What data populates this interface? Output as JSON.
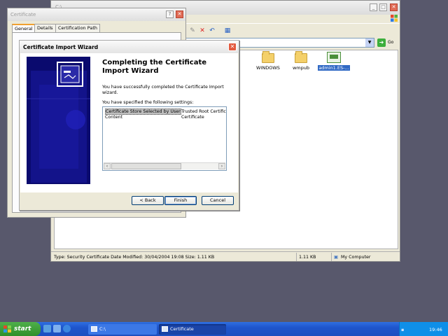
{
  "explorer": {
    "title": "C:\\",
    "address_value": "",
    "go_label": "Go",
    "files": [
      {
        "label": "WINDOWS",
        "kind": "folder",
        "selected": false
      },
      {
        "label": "wmpub",
        "kind": "folder",
        "selected": false
      },
      {
        "label": "admin1.ES-...",
        "kind": "certificate",
        "selected": true
      }
    ],
    "status": {
      "info": "Type: Security Certificate Date Modified: 30/04/2004 19:08 Size: 1.11 KB",
      "size": "1.11 KB",
      "zone": "My Computer"
    }
  },
  "cert_window": {
    "title": "Certificate",
    "help_label": "?",
    "close_label": "✕",
    "tabs": [
      "General",
      "Details",
      "Certification Path"
    ]
  },
  "wizard": {
    "title": "Certificate Import Wizard",
    "close_label": "✕",
    "heading": "Completing the Certificate Import Wizard",
    "intro": "You have successfully completed the Certificate Import wizard.",
    "settings_label": "You have specified the following settings:",
    "settings": [
      {
        "name": "Certificate Store Selected by User",
        "value": "Trusted Root Certific"
      },
      {
        "name": "Content",
        "value": "Certificate"
      }
    ],
    "buttons": {
      "back": "< Back",
      "finish": "Finish",
      "cancel": "Cancel"
    }
  },
  "taskbar": {
    "start_label": "start",
    "tasks": [
      {
        "label": "C:\\",
        "active": false
      },
      {
        "label": "Certificate",
        "active": true
      }
    ],
    "language": "EN",
    "clock": "19:46"
  },
  "colors": {
    "taskbar_blue": "#1e55cc",
    "start_green": "#2f8f2a",
    "banner_navy": "#0a0a6e",
    "close_red": "#e35a3f"
  }
}
